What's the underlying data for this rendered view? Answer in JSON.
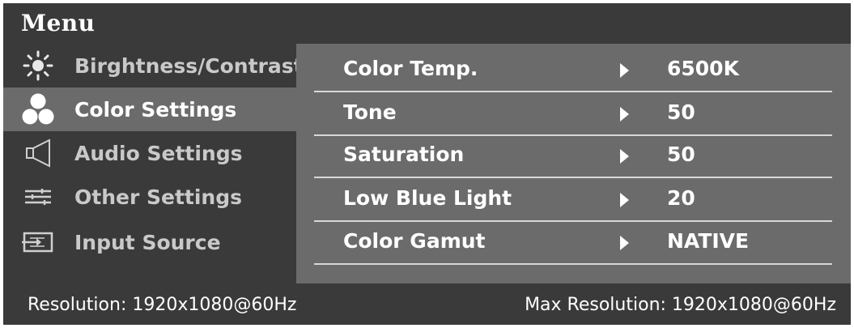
{
  "menu": {
    "title": "Menu",
    "items": [
      {
        "label": "Birghtness/Contrast",
        "icon": "brightness-icon",
        "selected": false
      },
      {
        "label": "Color Settings",
        "icon": "color-settings-icon",
        "selected": true
      },
      {
        "label": "Audio Settings",
        "icon": "speaker-icon",
        "selected": false
      },
      {
        "label": "Other Settings",
        "icon": "sliders-icon",
        "selected": false
      },
      {
        "label": "Input Source",
        "icon": "input-source-icon",
        "selected": false
      }
    ]
  },
  "submenu": {
    "rows": [
      {
        "label": "Color Temp.",
        "value": "6500K"
      },
      {
        "label": "Tone",
        "value": "50"
      },
      {
        "label": "Saturation",
        "value": "50"
      },
      {
        "label": "Low Blue Light",
        "value": "20"
      },
      {
        "label": "Color Gamut",
        "value": "NATIVE"
      }
    ]
  },
  "status": {
    "resolution": "Resolution: 1920x1080@60Hz",
    "max_resolution": "Max Resolution: 1920x1080@60Hz"
  },
  "colors": {
    "background": "#3a3a3a",
    "panel": "#6b6b6b",
    "text": "#ffffff",
    "dim_text": "#c9c9c9"
  }
}
